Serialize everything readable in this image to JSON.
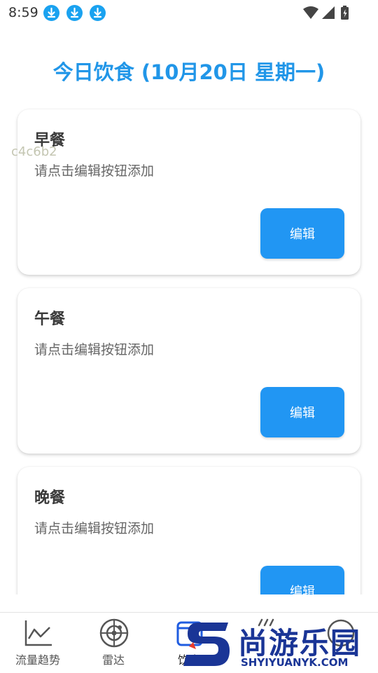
{
  "status_bar": {
    "time": "8:59",
    "icons": [
      "download-icon",
      "download-icon",
      "download-icon",
      "wifi-icon",
      "signal-icon",
      "battery-charging-icon"
    ]
  },
  "page": {
    "title": "今日饮食 (10月20日 星期一)",
    "debug_text": "c4c6b2"
  },
  "meals": [
    {
      "title": "早餐",
      "desc": "请点击编辑按钮添加",
      "button": "编辑"
    },
    {
      "title": "午餐",
      "desc": "请点击编辑按钮添加",
      "button": "编辑"
    },
    {
      "title": "晚餐",
      "desc": "请点击编辑按钮添加",
      "button": "编辑"
    }
  ],
  "bottom_nav": {
    "items": [
      {
        "label": "流量趋势",
        "icon": "line-chart-icon"
      },
      {
        "label": "雷达",
        "icon": "radar-icon"
      },
      {
        "label": "饮食",
        "icon": "diet-icon",
        "active": true
      },
      {
        "label": "",
        "icon": "unknown-icon"
      },
      {
        "label": "",
        "icon": "unknown-icon"
      }
    ]
  },
  "watermark": {
    "text": "尚游乐园",
    "url": "SHYIYUANYK.COM"
  },
  "colors": {
    "accent": "#2196f3",
    "title": "#2196e8",
    "download_icon": "#1aa2f0",
    "watermark": "#1a3596"
  }
}
